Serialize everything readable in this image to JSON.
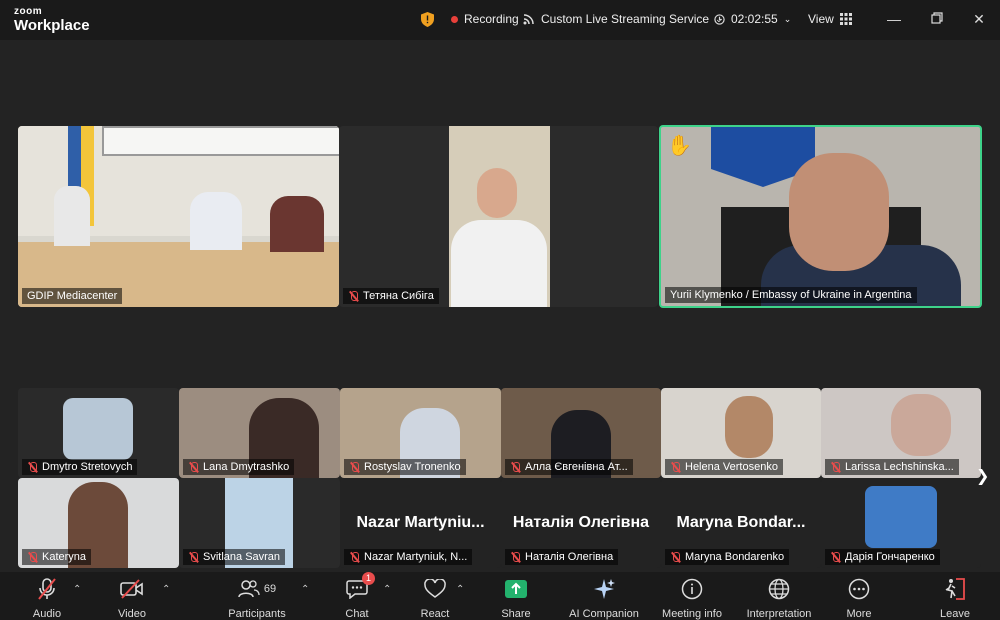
{
  "app": {
    "brand_top": "zoom",
    "brand_bottom": "Workplace"
  },
  "titlebar": {
    "recording": "Recording",
    "streaming": "Custom Live Streaming Service",
    "timer": "02:02:55",
    "view": "View"
  },
  "featured": [
    {
      "name": "GDIP Mediacenter",
      "muted": false
    },
    {
      "name": "Тетяна Сибіга",
      "muted": true
    },
    {
      "name": "Yurii Klymenko / Embassy of Ukraine in Argentina",
      "muted": false,
      "raised_hand": true,
      "active_speaker": true
    }
  ],
  "gallery_row1": [
    {
      "name": "Dmytro Stretovych"
    },
    {
      "name": "Lana Dmytrashko"
    },
    {
      "name": "Rostyslav Tronenko"
    },
    {
      "name": "Алла Євгенівна Ат..."
    },
    {
      "name": "Helena Vertosenko"
    },
    {
      "name": "Larissa Lechshinska..."
    }
  ],
  "gallery_row2": [
    {
      "name": "Kateryna",
      "big": ""
    },
    {
      "name": "Svitlana Savran",
      "big": ""
    },
    {
      "name": "Nazar Martyniuk, N...",
      "big": "Nazar  Martyniu..."
    },
    {
      "name": "Наталія Олегівна",
      "big": "Наталія Олегівна"
    },
    {
      "name": "Maryna Bondarenko",
      "big": "Maryna  Bondar..."
    },
    {
      "name": "Дарія Гончаренко",
      "big": ""
    }
  ],
  "toolbar": {
    "audio": "Audio",
    "video": "Video",
    "participants": "Participants",
    "participants_count": "69",
    "chat": "Chat",
    "chat_badge": "1",
    "react": "React",
    "share": "Share",
    "ai": "AI Companion",
    "info": "Meeting info",
    "interpretation": "Interpretation",
    "more": "More",
    "leave": "Leave"
  },
  "colors": {
    "accent_green": "#3ed38a",
    "muted_red": "#e84c4c",
    "share_green": "#23b26d"
  }
}
